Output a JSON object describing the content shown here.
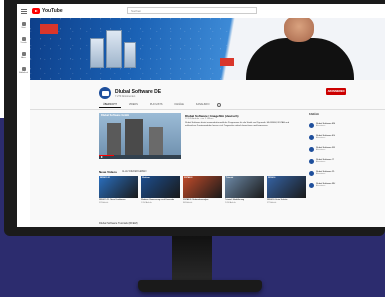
{
  "app": {
    "logo_text": "YouTube",
    "search_placeholder": "Suchen"
  },
  "sidebar": {
    "items": [
      {
        "label": "Start",
        "icon": "home-icon"
      },
      {
        "label": "Trends",
        "icon": "trending-icon"
      },
      {
        "label": "Abos",
        "icon": "subscriptions-icon"
      },
      {
        "label": "Bibliothek",
        "icon": "library-icon"
      }
    ]
  },
  "channel": {
    "name": "Dlubal Software DE",
    "subscribers": "7.270 Abonnenten",
    "subscribe_label": "ABONNIEREN"
  },
  "tabs": [
    "ÜBERSICHT",
    "VIDEOS",
    "PLAYLISTS",
    "KANÄLE",
    "KANALINFO"
  ],
  "featured": {
    "thumb_caption": "Dlubal Software GmbH",
    "title": "Dlubal Software | Imagefilm (deutsch)",
    "meta": "12.345 Aufrufe • vor 2 Jahren",
    "description": "Dlubal Software bietet anwenderfreundliche Programme für die Statik und Dynamik. Mit RFEM, RSTAB und zahlreichen Zusatzmodulen lassen sich Tragwerke einfach berechnen und bemessen.",
    "progress_pct": 18
  },
  "right_column": {
    "title": "KANÄLE",
    "items": [
      {
        "name": "Dlubal Software EN",
        "sub": "Abonnieren"
      },
      {
        "name": "Dlubal Software ES",
        "sub": "Abonnieren"
      },
      {
        "name": "Dlubal Software FR",
        "sub": "Abonnieren"
      },
      {
        "name": "Dlubal Software IT",
        "sub": "Abonnieren"
      },
      {
        "name": "Dlubal Software PL",
        "sub": "Abonnieren"
      },
      {
        "name": "Dlubal Software RU",
        "sub": "Abonnieren"
      }
    ]
  },
  "row1": {
    "title": "Neue Videos",
    "play_all": "ALLE WIEDERGEBEN",
    "videos": [
      {
        "thumb": "RFEM 5.21",
        "title": "RFEM 5.21: Neue Funktionen",
        "meta": "312 Aufrufe",
        "color": "#2a6fbf"
      },
      {
        "thumb": "Webinar",
        "title": "Webinar: Bemessung nach Eurocode",
        "meta": "1.204 Aufrufe",
        "color": "#1c4e8f"
      },
      {
        "thumb": "RSTAB 8",
        "title": "RSTAB 8: Stabwerksanalyse",
        "meta": "845 Aufrufe",
        "color": "#c14b2a"
      },
      {
        "thumb": "Tutorial",
        "title": "Tutorial: Modellierung",
        "meta": "2.058 Aufrufe",
        "color": "#6d8aa8"
      },
      {
        "thumb": "RFEM 6",
        "title": "RFEM 6: Erste Schritte",
        "meta": "977 Aufrufe",
        "color": "#3563a5"
      }
    ]
  },
  "row2": {
    "title": "Dlubal Software Tutorials (RFEM)"
  }
}
